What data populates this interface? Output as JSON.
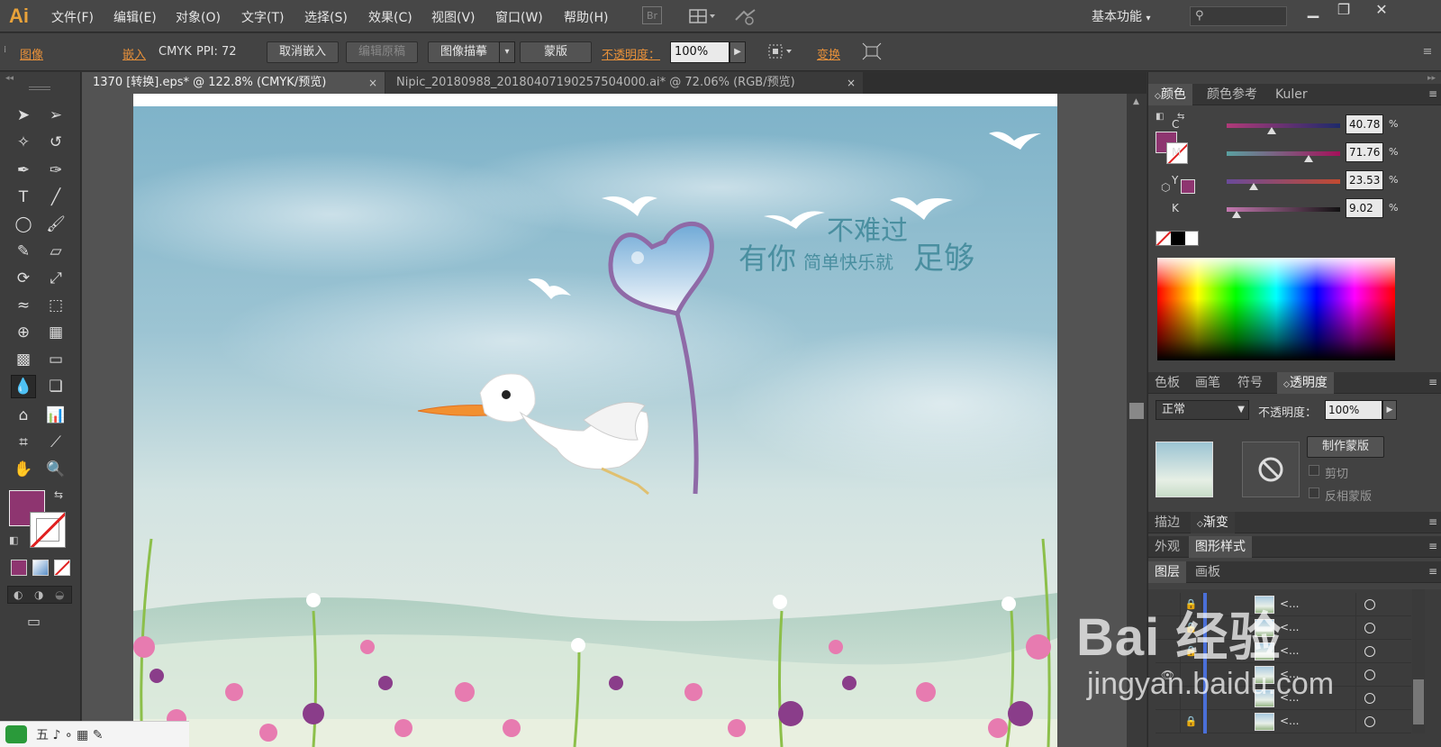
{
  "app": {
    "logo": "Ai"
  },
  "menu": [
    "文件(F)",
    "编辑(E)",
    "对象(O)",
    "文字(T)",
    "选择(S)",
    "效果(C)",
    "视图(V)",
    "窗口(W)",
    "帮助(H)"
  ],
  "bridge_label": "Br",
  "workspace": "基本功能",
  "control": {
    "label": "图像",
    "embed": "嵌入",
    "mode": "CMYK",
    "ppi": "PPI: 72",
    "unembed": "取消嵌入",
    "edit_original": "编辑原稿",
    "image_trace": "图像描摹",
    "mask": "蒙版",
    "opacity_label": "不透明度：",
    "opacity_value": "100%",
    "transform": "变换"
  },
  "tabs": [
    {
      "label": "1370 [转换].eps* @ 122.8% (CMYK/预览)",
      "close": "×"
    },
    {
      "label": "Nipic_20180988_20180407190257504000.ai* @ 72.06% (RGB/预览)",
      "close": "×"
    }
  ],
  "artwork_text": {
    "line1": "不难过",
    "line2a": "有你",
    "line2b": "简单快乐就",
    "line2c": "足够"
  },
  "color_panel": {
    "tabs": [
      "颜色",
      "颜色参考",
      "Kuler"
    ],
    "sliders": [
      {
        "label": "C",
        "value": "40.78",
        "frac": 0.4
      },
      {
        "label": "M",
        "value": "71.76",
        "frac": 0.72
      },
      {
        "label": "Y",
        "value": "23.53",
        "frac": 0.24
      },
      {
        "label": "K",
        "value": "9.02",
        "frac": 0.09
      }
    ],
    "unit": "%"
  },
  "transparency_panel": {
    "tabs": [
      "色板",
      "画笔",
      "符号",
      "透明度"
    ],
    "blend_mode": "正常",
    "opacity_label": "不透明度：",
    "opacity_value": "100%",
    "make_mask": "制作蒙版",
    "clip": "剪切",
    "invert": "反相蒙版"
  },
  "stroke_tabs": [
    "描边",
    "渐变"
  ],
  "appearance_tabs": [
    "外观",
    "图形样式"
  ],
  "layers_tabs": [
    "图层",
    "画板"
  ],
  "layers": [
    {
      "name": "<...",
      "lock": "🔒",
      "eye": ""
    },
    {
      "name": "<...",
      "lock": "🔒",
      "eye": ""
    },
    {
      "name": "<...",
      "lock": "🔒",
      "eye": ""
    },
    {
      "name": "<...",
      "lock": "",
      "eye": "👁"
    },
    {
      "name": "<...",
      "lock": "",
      "eye": ""
    },
    {
      "name": "<...",
      "lock": "🔒",
      "eye": ""
    }
  ],
  "watermark": {
    "brand": "Bai 经验",
    "url": "jingyan.baidu.com"
  },
  "colors": {
    "fill": "#8e3570",
    "accent": "#e8913a"
  }
}
